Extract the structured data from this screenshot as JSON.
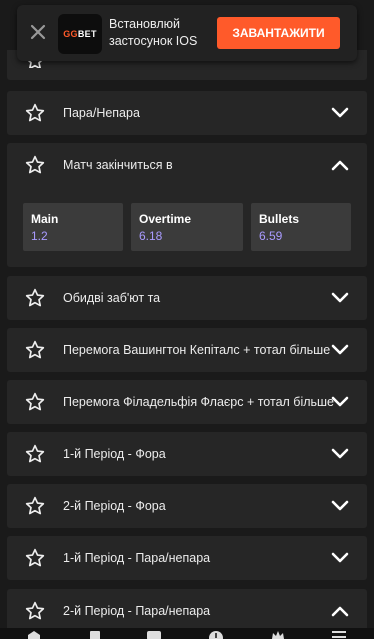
{
  "banner": {
    "logo_gg": "GG",
    "logo_bet": "BET",
    "message": "Встановлюй застосунок IOS",
    "cta_label": "ЗАВАНТАЖИТИ"
  },
  "markets": [
    {
      "title": "Пара/Непара",
      "expanded": false
    },
    {
      "title": "Матч закінчиться в",
      "expanded": true,
      "odds": [
        {
          "name": "Main",
          "value": "1.2"
        },
        {
          "name": "Overtime",
          "value": "6.18"
        },
        {
          "name": "Bullets",
          "value": "6.59"
        }
      ]
    },
    {
      "title": "Обидві заб'ют та",
      "expanded": false
    },
    {
      "title": "Перемога Вашингтон Кепіталс + тотал більше",
      "expanded": false
    },
    {
      "title": "Перемога Філадельфія Флаєрс + тотал більше",
      "expanded": false
    },
    {
      "title": "1-й Період - Фора",
      "expanded": false
    },
    {
      "title": "2-й Період - Фора",
      "expanded": false
    },
    {
      "title": "1-й Період - Пара/непара",
      "expanded": false
    },
    {
      "title": "2-й Період - Пара/непара",
      "expanded": true
    }
  ],
  "colors": {
    "accent": "#ff5a2a",
    "odds_value": "#a99bff",
    "row_bg": "#262626",
    "page_bg": "#1a1a1a"
  },
  "icons": [
    "close-icon",
    "star-icon",
    "chevron-down-icon",
    "chevron-up-icon",
    "home-icon",
    "cards-icon",
    "bet-icon",
    "clock-icon",
    "crown-icon",
    "menu-icon"
  ]
}
